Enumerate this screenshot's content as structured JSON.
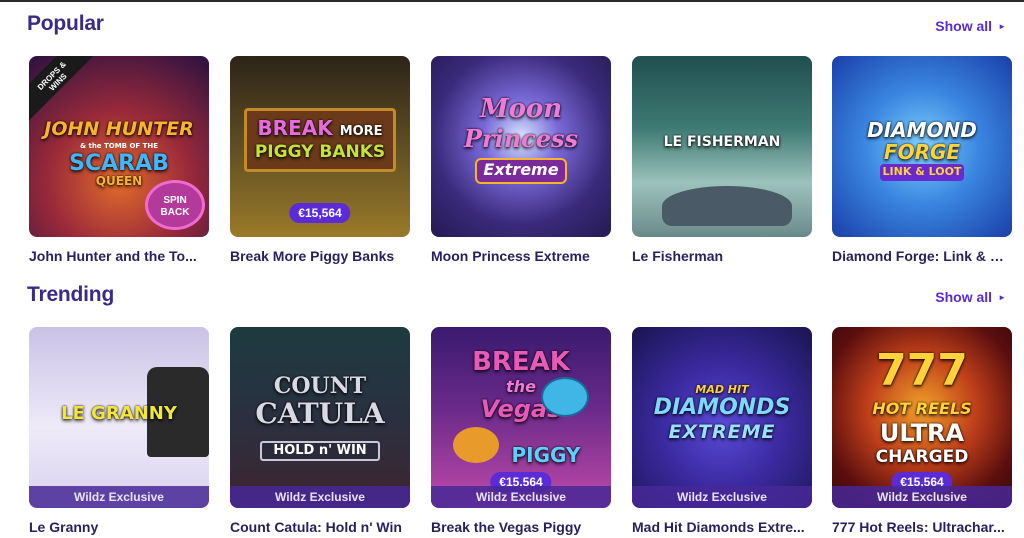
{
  "sections": {
    "popular": {
      "title": "Popular",
      "show_all": "Show all",
      "games": [
        {
          "title": "John Hunter and the To...",
          "art": {
            "line1": "JOHN HUNTER",
            "line2": "& the TOMB OF THE",
            "line3": "SCARAB",
            "line4": "QUEEN",
            "corner": "DROPS & WINS",
            "stamp": "SPIN BACK"
          },
          "colors": {
            "bg1": "#2a1140",
            "bg2": "#c2462a",
            "accent": "#f7b52b"
          }
        },
        {
          "title": "Break More Piggy Banks",
          "art": {
            "line1": "BREAK",
            "line1b": "MORE",
            "line2": "PIGGY BANKS"
          },
          "amount": "€15,564",
          "colors": {
            "bg1": "#3b2a18",
            "bg2": "#8a6a2a",
            "accent": "#c4e23a"
          }
        },
        {
          "title": "Moon Princess Extreme",
          "art": {
            "line1": "Moon",
            "line2": "Princess",
            "line3": "Extreme"
          },
          "colors": {
            "bg1": "#2c2a6b",
            "bg2": "#6b3fb8",
            "accent": "#f07ad6"
          }
        },
        {
          "title": "Le Fisherman",
          "art": {
            "line1": "LE FISHERMAN"
          },
          "colors": {
            "bg1": "#1f5a57",
            "bg2": "#6fa6a0",
            "accent": "#ffffff"
          }
        },
        {
          "title": "Diamond Forge: Link & L...",
          "art": {
            "line1": "DIAMOND",
            "line2": "FORGE",
            "line3": "LINK & LOOT"
          },
          "colors": {
            "bg1": "#1a3fa8",
            "bg2": "#58b0f0",
            "accent": "#ffd23a"
          }
        }
      ]
    },
    "trending": {
      "title": "Trending",
      "show_all": "Show all",
      "games": [
        {
          "title": "Le Granny",
          "art": {
            "line1": "LE GRANNY"
          },
          "exclusive": "Wildz Exclusive",
          "colors": {
            "bg1": "#c9c2e6",
            "bg2": "#ffffff",
            "accent": "#f2e63a"
          }
        },
        {
          "title": "Count Catula: Hold n' Win",
          "art": {
            "line1": "COUNT",
            "line2": "CATULA",
            "line3": "HOLD n' WIN"
          },
          "exclusive": "Wildz Exclusive",
          "colors": {
            "bg1": "#1d3b3f",
            "bg2": "#3f2430",
            "accent": "#d9d9e6"
          }
        },
        {
          "title": "Break the Vegas Piggy",
          "art": {
            "line1": "BREAK",
            "line2": "the",
            "line3": "Vegas",
            "line4": "PIGGY"
          },
          "amount": "€15,564",
          "exclusive": "Wildz Exclusive",
          "colors": {
            "bg1": "#3a1a6e",
            "bg2": "#c04aa8",
            "accent": "#e85ab8"
          }
        },
        {
          "title": "Mad Hit Diamonds Extre...",
          "art": {
            "line1": "MAD HIT",
            "line2": "DIAMONDS",
            "line3": "EXTREME"
          },
          "exclusive": "Wildz Exclusive",
          "colors": {
            "bg1": "#1a1450",
            "bg2": "#3b2aa0",
            "accent": "#7fd6ff"
          }
        },
        {
          "title": "777 Hot Reels: Ultrachar...",
          "art": {
            "line1": "777",
            "line2": "HOT REELS",
            "line3": "ULTRA",
            "line4": "CHARGED"
          },
          "amount": "€15,564",
          "exclusive": "Wildz Exclusive",
          "colors": {
            "bg1": "#3a0808",
            "bg2": "#d8501a",
            "accent": "#ffd23a"
          }
        }
      ]
    }
  }
}
